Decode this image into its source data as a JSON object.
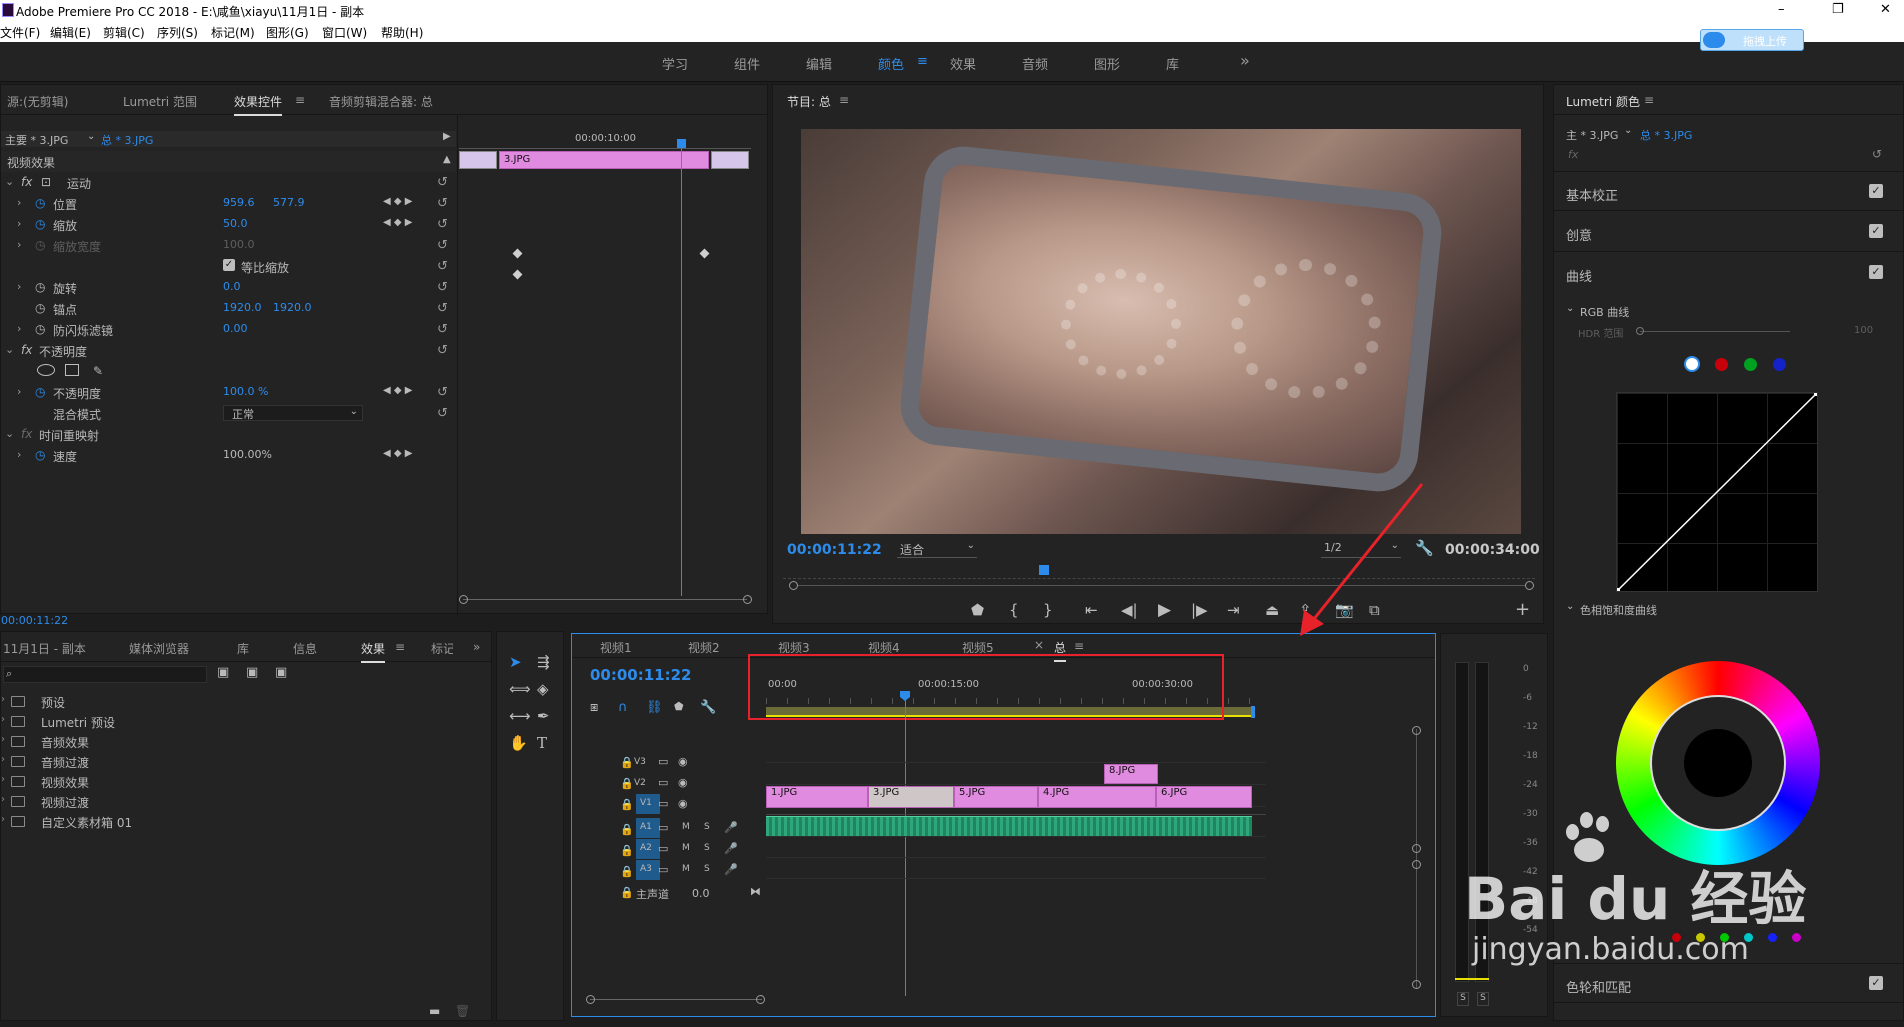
{
  "app": {
    "title": "Adobe Premiere Pro CC 2018 - E:\\咸鱼\\xiayu\\11月1日 - 副本",
    "window_controls": [
      "–",
      "❐",
      "✕"
    ]
  },
  "menu": [
    "文件(F)",
    "编辑(E)",
    "剪辑(C)",
    "序列(S)",
    "标记(M)",
    "图形(G)",
    "窗口(W)",
    "帮助(H)"
  ],
  "workspaces": {
    "items": [
      "学习",
      "组件",
      "编辑",
      "颜色",
      "效果",
      "音频",
      "图形",
      "库"
    ],
    "active": "颜色",
    "more": "»",
    "upload_label": "拖拽上传"
  },
  "source_panel": {
    "tabs": [
      "源:(无剪辑)",
      "Lumetri 范围",
      "效果控件",
      "音频剪辑混合器: 总"
    ],
    "active_tab": "效果控件",
    "clip_master": "主要 * 3.JPG",
    "clip_seq": "总 * 3.JPG",
    "mini_timecode": "00:00:10:00",
    "mini_clip": "3.JPG",
    "section_video": "视频效果",
    "motion": "运动",
    "position_label": "位置",
    "position_x": "959.6",
    "position_y": "577.9",
    "scale_label": "缩放",
    "scale_val": "50.0",
    "scale_width_label": "缩放宽度",
    "scale_width_val": "100.0",
    "uniform_scale_label": "等比缩放",
    "rotate_label": "旋转",
    "rotate_val": "0.0",
    "anchor_label": "锚点",
    "anchor_x": "1920.0",
    "anchor_y": "1920.0",
    "flicker_label": "防闪烁滤镜",
    "flicker_val": "0.00",
    "opacity_group": "不透明度",
    "opacity_label": "不透明度",
    "opacity_val": "100.0 %",
    "blend_label": "混合模式",
    "blend_val": "正常",
    "time_remap": "时间重映射",
    "speed_label": "速度",
    "speed_val": "100.00%",
    "timecode": "00:00:11:22"
  },
  "program_monitor": {
    "title": "节目: 总",
    "timecode": "00:00:11:22",
    "fit": "适合",
    "resolution": "1/2",
    "duration": "00:00:34:00"
  },
  "project_panel": {
    "tabs": [
      "11月1日 - 副本",
      "媒体浏览器",
      "库",
      "信息",
      "效果",
      "标记"
    ],
    "active_tab": "效果",
    "folders": [
      "预设",
      "Lumetri 预设",
      "音频效果",
      "音频过渡",
      "视频效果",
      "视频过渡",
      "自定义素材箱 01"
    ]
  },
  "timeline": {
    "tabs": [
      "视频1",
      "视频2",
      "视频3",
      "视频4",
      "视频5",
      "总"
    ],
    "active_tab": "总",
    "timecode": "00:00:11:22",
    "ruler": [
      "00:00",
      "00:00:15:00",
      "00:00:30:00"
    ],
    "tracks_video": [
      "V3",
      "V2",
      "V1"
    ],
    "tracks_audio": [
      "A1",
      "A2",
      "A3"
    ],
    "master_label": "主声道",
    "master_val": "0.0",
    "clips_v1": [
      "1.JPG",
      "3.JPG",
      "5.JPG",
      "4.JPG",
      "6.JPG"
    ],
    "clip_v2": "8.JPG",
    "mute": "M",
    "solo": "S"
  },
  "audio_meter": {
    "scale": [
      "0",
      "-6",
      "-12",
      "-18",
      "-24",
      "-30",
      "-36",
      "-42",
      "-48",
      "-54"
    ],
    "solo_buttons": [
      "S",
      "S"
    ]
  },
  "lumetri": {
    "title": "Lumetri 颜色",
    "clip_master": "主 * 3.JPG",
    "clip_seq": "总 * 3.JPG",
    "fx": "fx",
    "sections": [
      "基本校正",
      "创意",
      "曲线"
    ],
    "rgb_curves": "RGB 曲线",
    "hdr_label": "HDR 范围",
    "hdr_val": "100",
    "hue_sat": "色相饱和度曲线",
    "wheels": "色轮和匹配",
    "curve_colors": [
      "#ffffff",
      "#c8000c",
      "#00a020",
      "#1522c8"
    ],
    "dots_colors": [
      "#c8000c",
      "#c8c800",
      "#00c800",
      "#00c8c8",
      "#1522ff",
      "#c800c8"
    ]
  },
  "colors": {
    "accent": "#2d8ceb",
    "clip_pink": "#e18be0",
    "audio_green": "#2fa77c",
    "highlight_red": "#e8222b",
    "playhead": "#2d8ceb"
  },
  "watermark": {
    "logo": "Bai du 经验",
    "url": "jingyan.baidu.com"
  }
}
